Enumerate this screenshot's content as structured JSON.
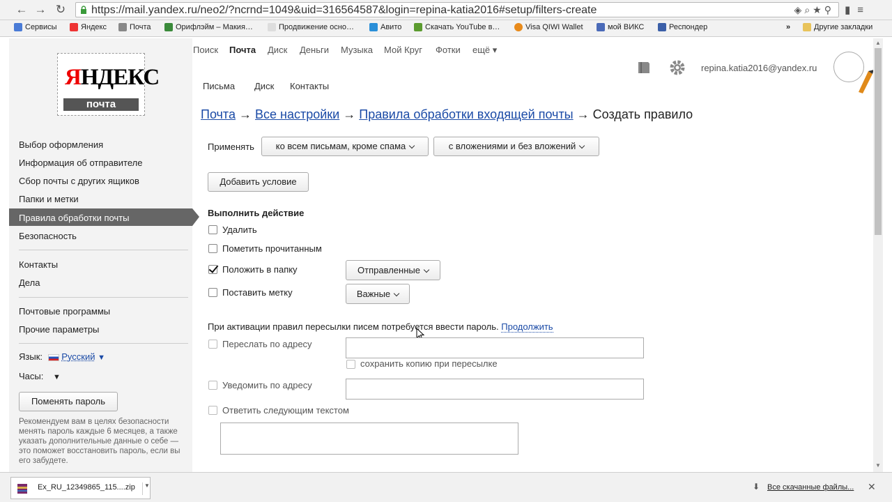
{
  "browser": {
    "url": "https://mail.yandex.ru/neo2/?ncrnd=1049&uid=316564587&login=repina-katia2016#setup/filters-create",
    "bookmarks": [
      {
        "label": "Сервисы",
        "color": "#4a7bd6"
      },
      {
        "label": "Яндекс",
        "color": "#e33"
      },
      {
        "label": "Почта",
        "color": "#888"
      },
      {
        "label": "Орифлэйм – Макия…",
        "color": "#3a8a3a"
      },
      {
        "label": "Продвижение осно…",
        "color": "#bbb"
      },
      {
        "label": "Авито",
        "color": "#2a8fd8"
      },
      {
        "label": "Скачать YouTube в…",
        "color": "#5b9b2f"
      },
      {
        "label": "Visa QIWI Wallet",
        "color": "#e88a1a"
      },
      {
        "label": "мой ВИКС",
        "color": "#4a6ab8"
      },
      {
        "label": "Респондер",
        "color": "#3b5fa8"
      }
    ],
    "bookmarks_more": "»",
    "other_bookmarks": "Другие закладки"
  },
  "logo": {
    "name_first": "Я",
    "name_rest": "НДЕКС",
    "sub": "почта"
  },
  "top_nav": [
    "Поиск",
    "Почта",
    "Диск",
    "Деньги",
    "Музыка",
    "Мой Круг",
    "Фотки",
    "ещё ▾"
  ],
  "sub_nav": [
    "Письма",
    "Диск",
    "Контакты"
  ],
  "user_email": "repina.katia2016@yandex.ru",
  "sidebar": {
    "items": [
      "Выбор оформления",
      "Информация об отправителе",
      "Сбор почты с других ящиков",
      "Папки и метки",
      "Правила обработки почты",
      "Безопасность",
      "Контакты",
      "Дела",
      "Почтовые программы",
      "Прочие параметры"
    ],
    "language_label": "Язык:",
    "language_value": "Русский",
    "clock_label": "Часы:",
    "change_password": "Поменять пароль",
    "recommendation": "Рекомендуем вам в целях безопасности менять пароль каждые 6 месяцев, а также указать дополнительные данные о себе — это поможет восстановить пароль, если вы его забудете."
  },
  "breadcrumb": {
    "items": [
      "Почта",
      "Все настройки",
      "Правила обработки входящей почты"
    ],
    "separator": "→",
    "current": "Создать правило"
  },
  "apply": {
    "label": "Применять",
    "scope": "ко всем письмам, кроме спама",
    "attachments": "с вложениями и без вложений"
  },
  "add_condition": "Добавить условие",
  "actions": {
    "title": "Выполнить действие",
    "delete": "Удалить",
    "mark_read": "Пометить прочитанным",
    "move_to_folder": "Положить в папку",
    "folder_value": "Отправленные",
    "set_label": "Поставить метку",
    "label_value": "Важные"
  },
  "forward": {
    "notice": "При активации правил пересылки писем потребуется ввести пароль.",
    "continue": "Продолжить",
    "forward_to": "Переслать по адресу",
    "keep_copy": "сохранить копию при пересылке",
    "notify": "Уведомить по адресу",
    "reply": "Ответить следующим текстом"
  },
  "downloads": {
    "file": "Ex_RU_12349865_115....zip",
    "all": "Все скачанные файлы..."
  }
}
